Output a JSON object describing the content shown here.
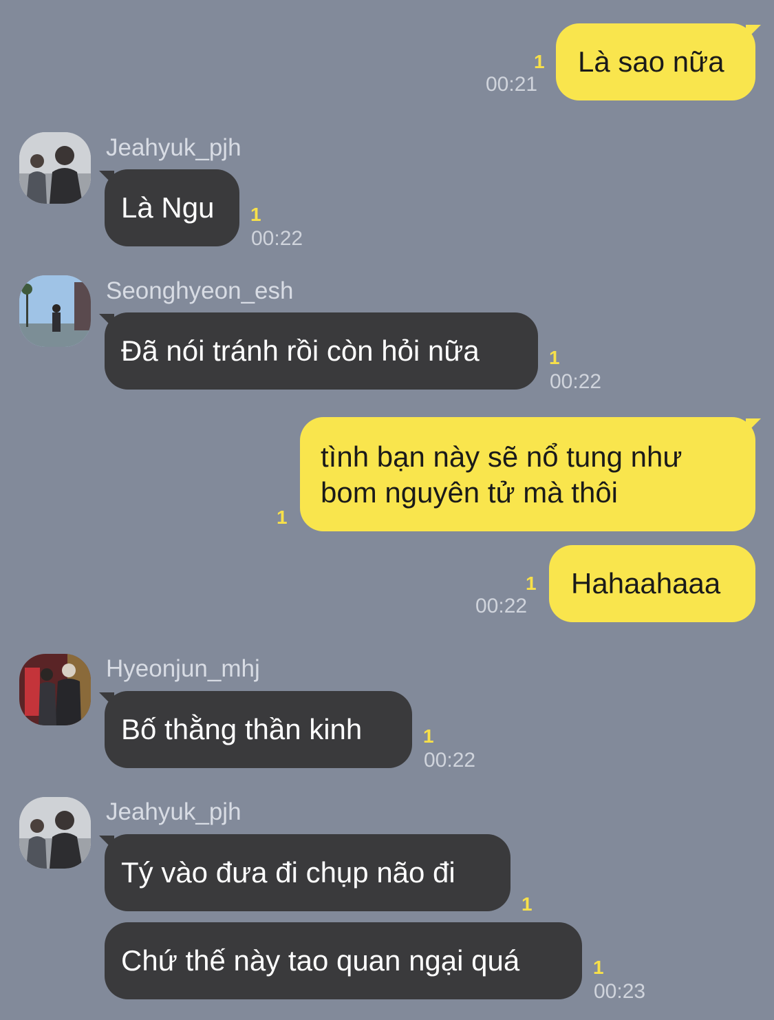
{
  "messages": [
    {
      "text": "Là sao nữa",
      "unread": "1",
      "time": "00:21"
    },
    {
      "sender": "Jeahyuk_pjh",
      "text": "Là Ngu",
      "unread": "1",
      "time": "00:22"
    },
    {
      "sender": "Seonghyeon_esh",
      "text": "Đã nói tránh rồi còn hỏi nữa",
      "unread": "1",
      "time": "00:22"
    },
    {
      "text_line1": "tình bạn này sẽ nổ tung như",
      "text_line2": "bom nguyên tử mà thôi",
      "unread": "1"
    },
    {
      "text": "Hahaahaaa",
      "unread": "1",
      "time": "00:22"
    },
    {
      "sender": "Hyeonjun_mhj",
      "text": "Bố thằng thần kinh",
      "unread": "1",
      "time": "00:22"
    },
    {
      "sender": "Jeahyuk_pjh",
      "text": "Tý vào đưa đi chụp não đi",
      "unread": "1"
    },
    {
      "text": "Chứ thế này tao quan ngại quá",
      "unread": "1",
      "time": "00:23"
    }
  ],
  "colors": {
    "background": "#828A9A",
    "my_bubble": "#F9E54D",
    "their_bubble": "#3A3A3C",
    "unread": "#F7E04A"
  }
}
